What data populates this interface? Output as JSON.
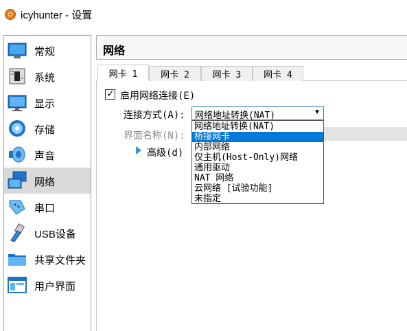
{
  "window": {
    "title": "icyhunter - 设置"
  },
  "sidebar": {
    "items": [
      {
        "label": "常规",
        "icon": "general-icon"
      },
      {
        "label": "系统",
        "icon": "motherboard-icon"
      },
      {
        "label": "显示",
        "icon": "monitor-icon"
      },
      {
        "label": "存储",
        "icon": "storage-disk-icon"
      },
      {
        "label": "声音",
        "icon": "speaker-icon"
      },
      {
        "label": "网络",
        "icon": "network-icon",
        "selected": true
      },
      {
        "label": "串口",
        "icon": "serial-port-icon"
      },
      {
        "label": "USB设备",
        "icon": "usb-icon"
      },
      {
        "label": "共享文件夹",
        "icon": "folder-icon"
      },
      {
        "label": "用户界面",
        "icon": "user-interface-icon"
      }
    ]
  },
  "panel": {
    "title": "网络"
  },
  "tabs": [
    "网卡 1",
    "网卡 2",
    "网卡 3",
    "网卡 4"
  ],
  "active_tab": 0,
  "adapter": {
    "enable_label": "启用网络连接(E)",
    "enable_checked": true,
    "attach_label": "连接方式(A):",
    "attach_value": "网络地址转换(NAT)",
    "iface_label": "界面名称(N):",
    "advanced_label": "高级(d)"
  },
  "dropdown": {
    "options": [
      "网络地址转换(NAT)",
      "桥接网卡",
      "内部网络",
      "仅主机(Host-Only)网络",
      "通用驱动",
      "NAT 网络",
      "云网络 [试验功能]",
      "未指定"
    ],
    "highlighted_index": 1
  },
  "colors": {
    "selection": "#0078d7",
    "sidebar_selected": "#d9d9d9",
    "accent_border": "#3b78d8"
  }
}
